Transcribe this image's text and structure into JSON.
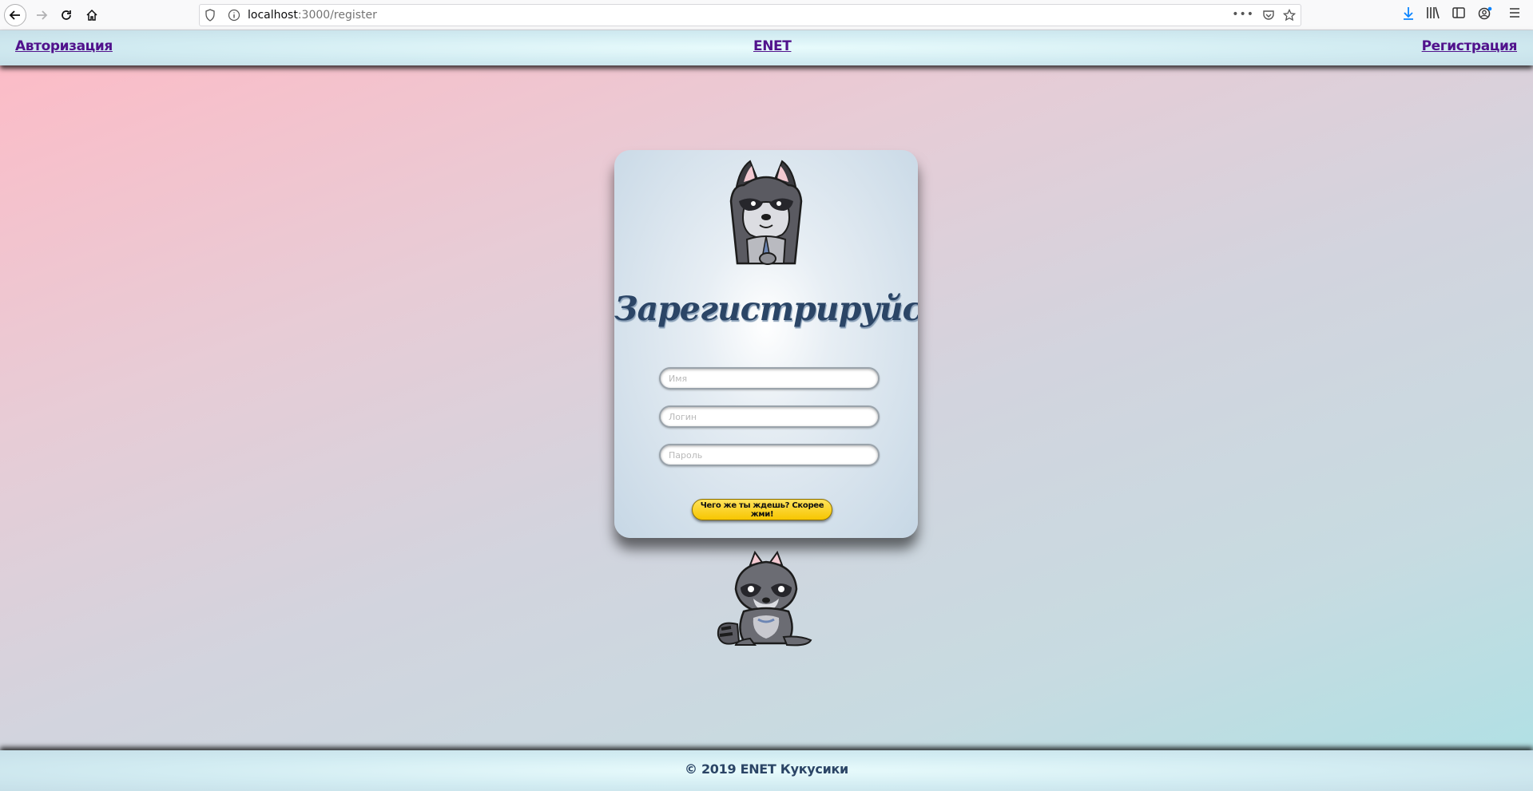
{
  "browser": {
    "url_host": "localhost",
    "url_path": ":3000/register",
    "more_icon": "ellipsis-icon",
    "more_label": "•••"
  },
  "header": {
    "login_link": "Авторизация",
    "brand_link": "ENET",
    "register_link": "Регистрация"
  },
  "card": {
    "title": "Зарегистрируйся!",
    "name_placeholder": "Имя",
    "login_placeholder": "Логин",
    "password_placeholder": "Пароль",
    "submit_label": "Чего же ты ждешь? Скорее жми!"
  },
  "footer": {
    "text": "© 2019 ENET Кукусики"
  },
  "colors": {
    "link": "#51128c",
    "title": "#2b4566",
    "button": "#f7c600"
  }
}
